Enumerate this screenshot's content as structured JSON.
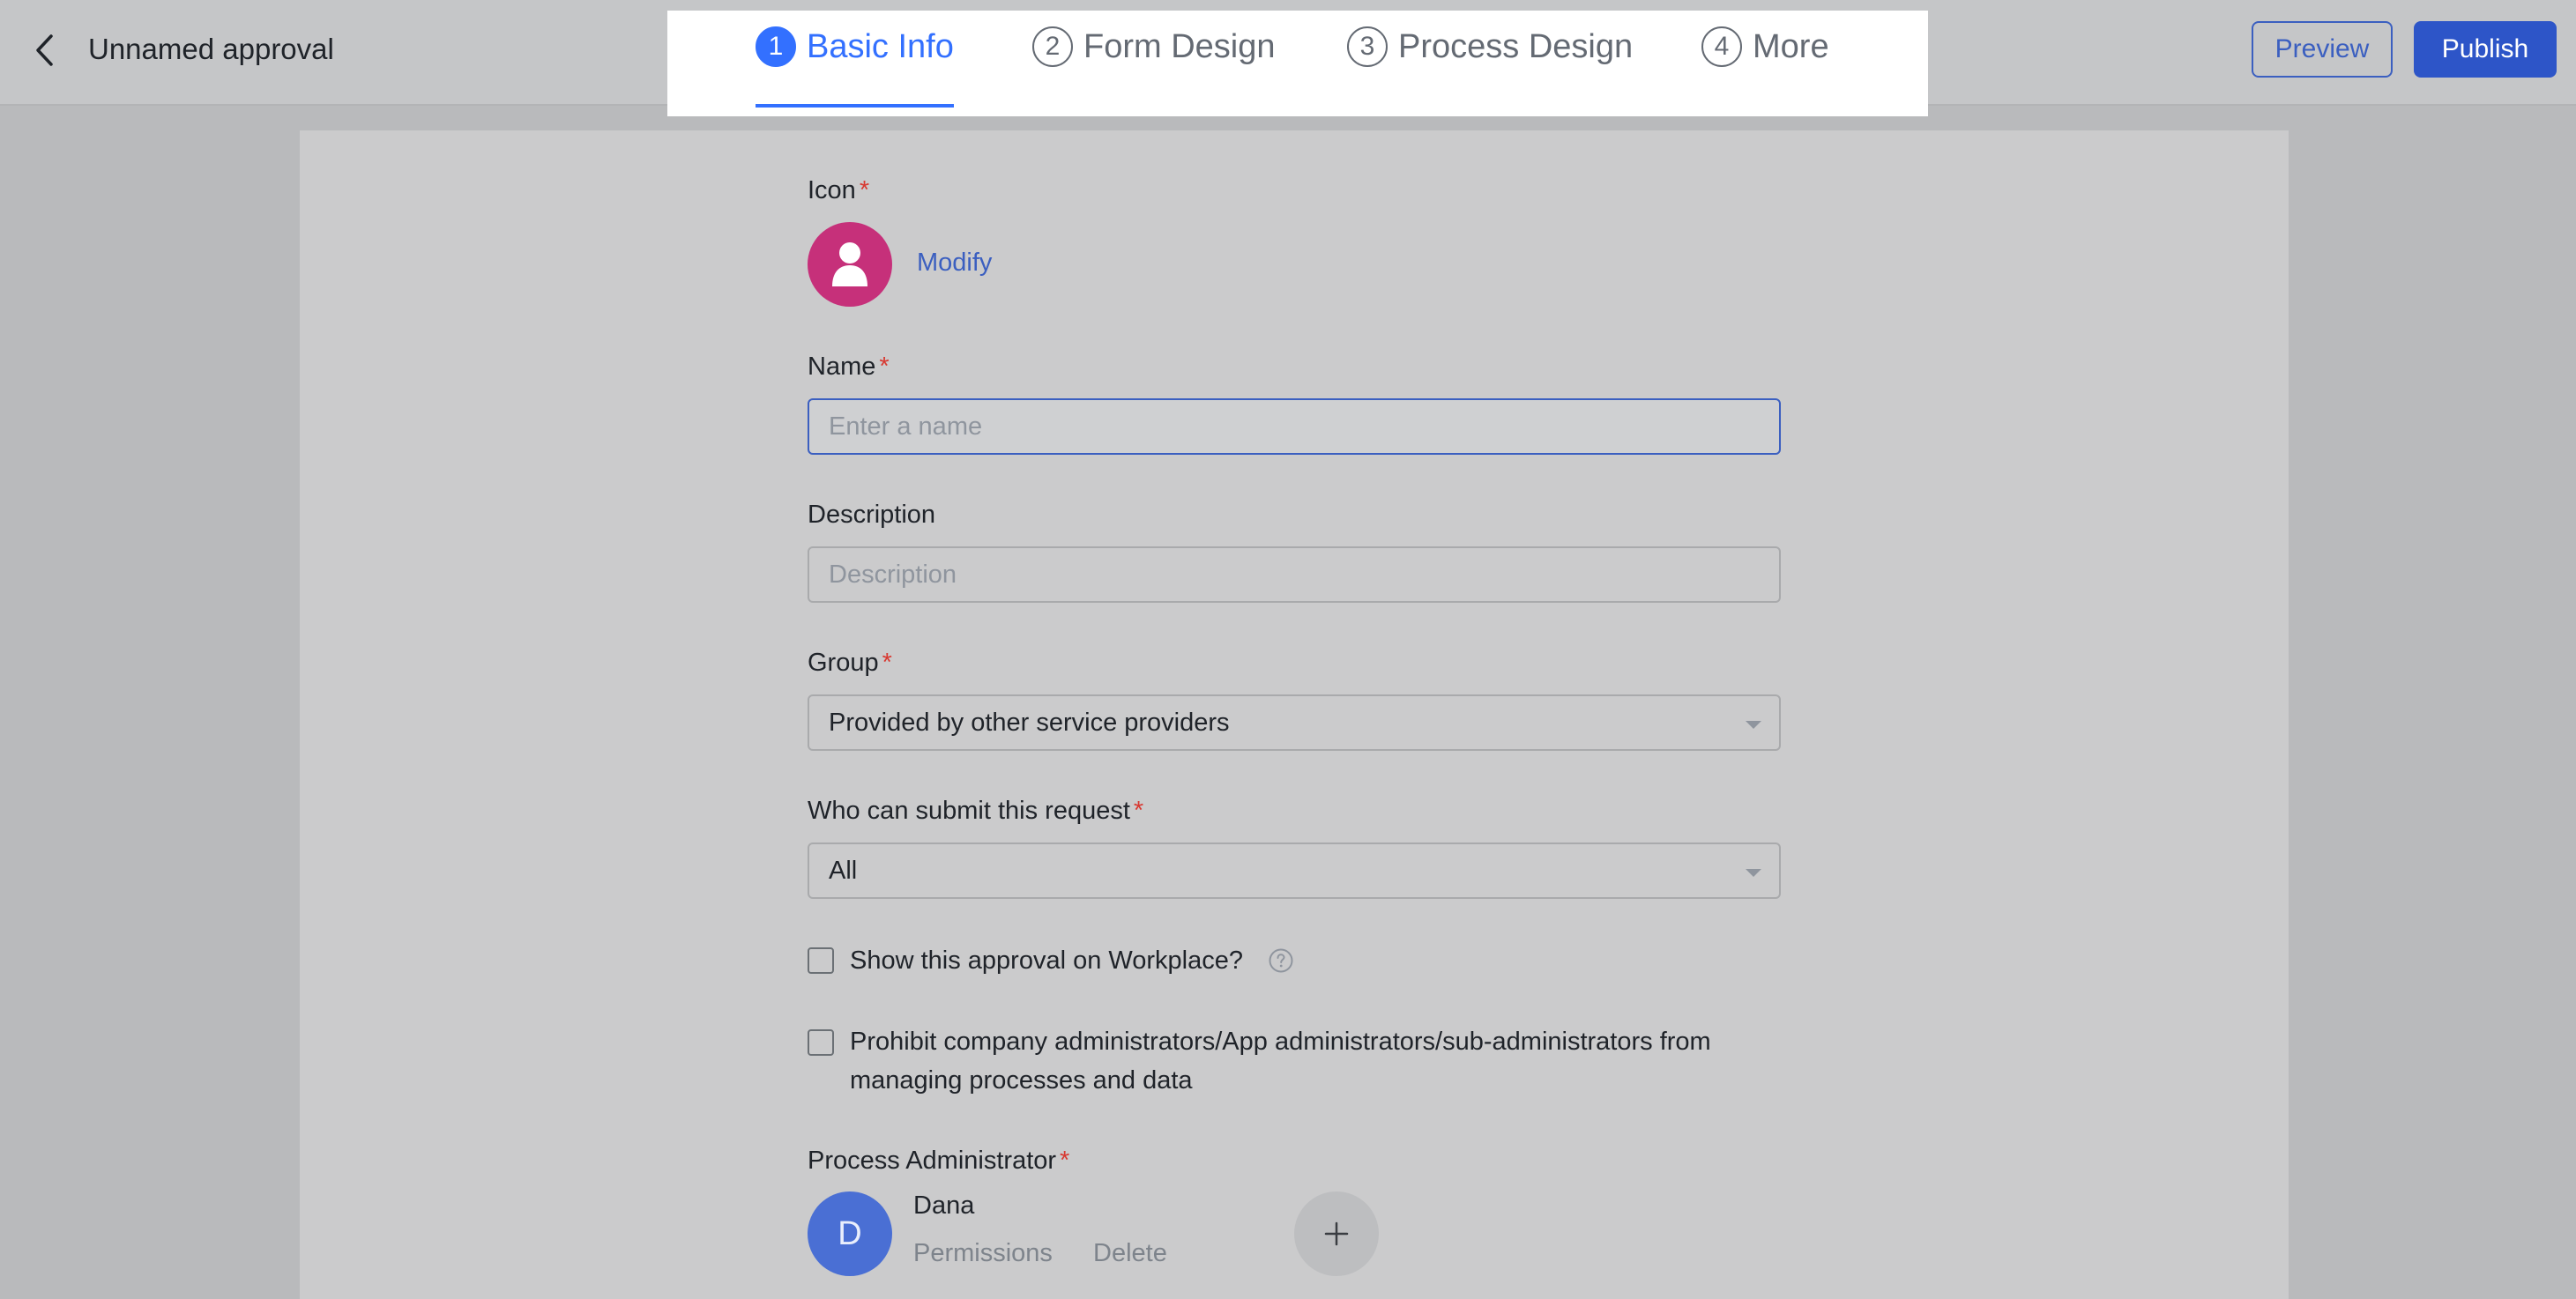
{
  "header": {
    "title": "Unnamed approval",
    "preview_label": "Preview",
    "publish_label": "Publish"
  },
  "steps": [
    {
      "num": "1",
      "label": "Basic Info",
      "active": true
    },
    {
      "num": "2",
      "label": "Form Design",
      "active": false
    },
    {
      "num": "3",
      "label": "Process Design",
      "active": false
    },
    {
      "num": "4",
      "label": "More",
      "active": false
    }
  ],
  "form": {
    "icon_label": "Icon",
    "modify_label": "Modify",
    "name_label": "Name",
    "name_placeholder": "Enter a name",
    "name_value": "",
    "description_label": "Description",
    "description_placeholder": "Description",
    "group_label": "Group",
    "group_value": "Provided by other service providers",
    "submit_label": "Who can submit this request",
    "submit_value": "All",
    "show_workplace_label": "Show this approval on Workplace?",
    "show_workplace_checked": false,
    "prohibit_line1": "Prohibit company administrators/App administrators/sub-administrators from",
    "prohibit_line2": "managing processes and data",
    "prohibit_checked": false,
    "process_admin_label": "Process Administrator",
    "required_mark": "*"
  },
  "admin": {
    "initial": "D",
    "name": "Dana",
    "permissions_label": "Permissions",
    "delete_label": "Delete"
  },
  "colors": {
    "accent": "#3370ff",
    "icon_bg": "#c6307a",
    "required": "#d83931",
    "admin_avatar": "#4a6fd4"
  }
}
